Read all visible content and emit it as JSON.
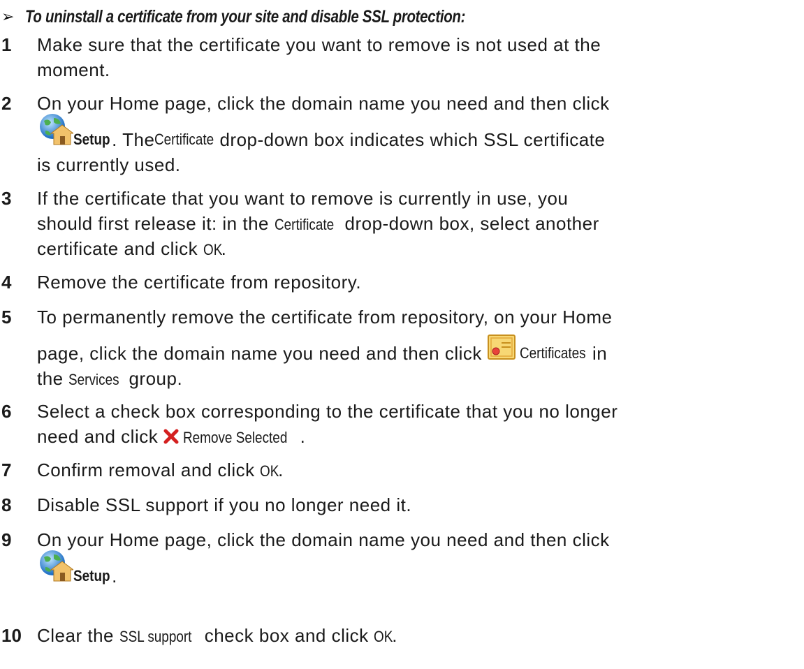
{
  "heading": "To uninstall a certificate from your site and disable SSL protection:",
  "steps": {
    "s1": {
      "num": "1",
      "line1": "Make sure that the certificate you want to remove is not used at the",
      "line2": "moment."
    },
    "s2": {
      "num": "2",
      "line1": "On your Home page, click the domain name you need and then click",
      "setup": "Setup",
      "after_setup": ". The ",
      "certificate": "Certificate",
      "line2_rest": " drop-down box indicates which SSL certificate",
      "line3": "is currently used."
    },
    "s3": {
      "num": "3",
      "line1": "If the certificate that you want to remove is currently in use, you",
      "line2_a": "should first release it: in the ",
      "certificate": "Certificate",
      "line2_b": " drop-down box, select another",
      "line3_a": "certificate and click ",
      "ok": "OK",
      "line3_b": "."
    },
    "s4": {
      "num": "4",
      "line1": "Remove the certificate from repository."
    },
    "s5": {
      "num": "5",
      "line1": "To permanently remove the certificate from repository, on your Home",
      "line2_a": "page, click the domain name you need and then click",
      "certificates": "Certificates",
      "line2_b": " in",
      "line3_a": "the ",
      "services": "Services",
      "line3_b": " group."
    },
    "s6": {
      "num": "6",
      "line1": "Select a check box corresponding to the certificate that you no longer",
      "line2_a": "need and click ",
      "remove_selected": "Remove Selected",
      "line2_b": "."
    },
    "s7": {
      "num": "7",
      "line1_a": "Confirm removal and click ",
      "ok": "OK",
      "line1_b": "."
    },
    "s8": {
      "num": "8",
      "line1": "Disable SSL support if you no longer need it."
    },
    "s9": {
      "num": "9",
      "line1": "On your Home page, click the domain name you need and then click",
      "setup": "Setup",
      "line2_b": "."
    },
    "s10": {
      "num": "10",
      "line1_a": "Clear the ",
      "ssl_support": "SSL support",
      "line1_b": " check box and click ",
      "ok": "OK",
      "line1_c": "."
    }
  },
  "icons": {
    "setup": "globe-house-icon",
    "certificates": "certificate-icon",
    "remove": "red-x-icon"
  }
}
